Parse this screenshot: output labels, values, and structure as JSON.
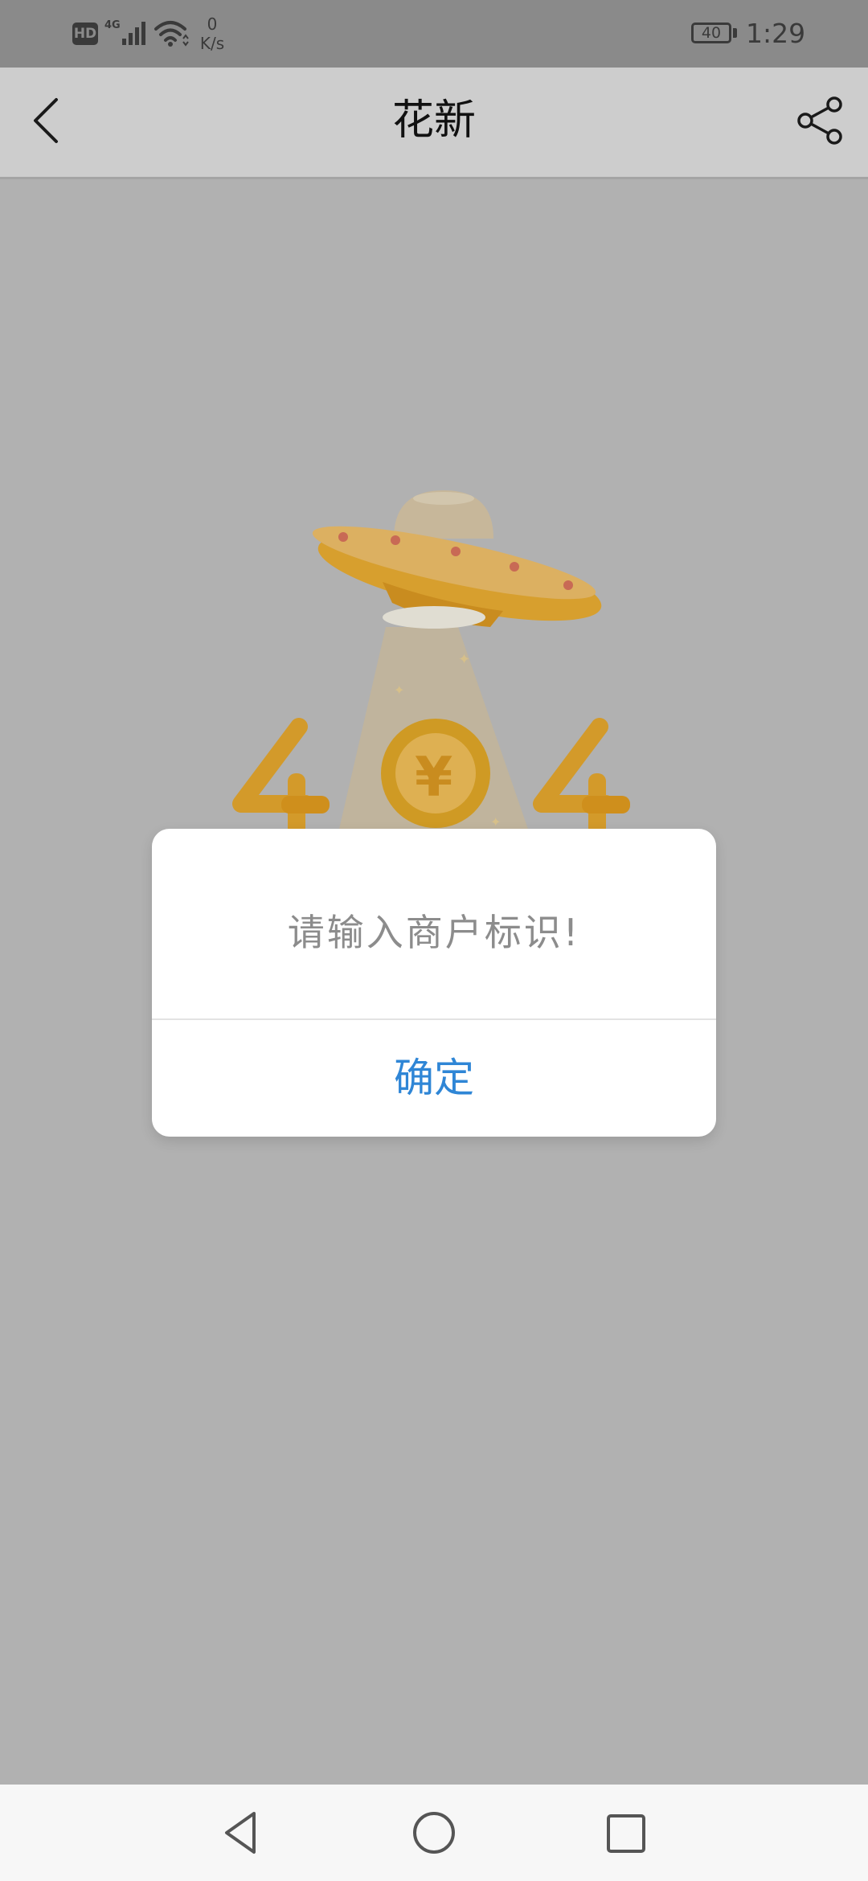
{
  "status_bar": {
    "hd_badge": "HD",
    "network_type": "4G",
    "speed_value": "0",
    "speed_unit": "K/s",
    "battery_level": "40",
    "time": "1:29"
  },
  "header": {
    "title": "花新",
    "back_icon": "chevron-left-icon",
    "share_icon": "share-icon"
  },
  "illustration": {
    "error_code": "404",
    "icon": "ufo-coin-404-illustration",
    "accent_color": "#e6a52a"
  },
  "dialog": {
    "message": "请输入商户标识!",
    "confirm_label": "确定",
    "confirm_color": "#2f86d6"
  },
  "navbar": {
    "back_icon": "triangle-back-icon",
    "home_icon": "circle-home-icon",
    "recent_icon": "square-recent-icon"
  }
}
